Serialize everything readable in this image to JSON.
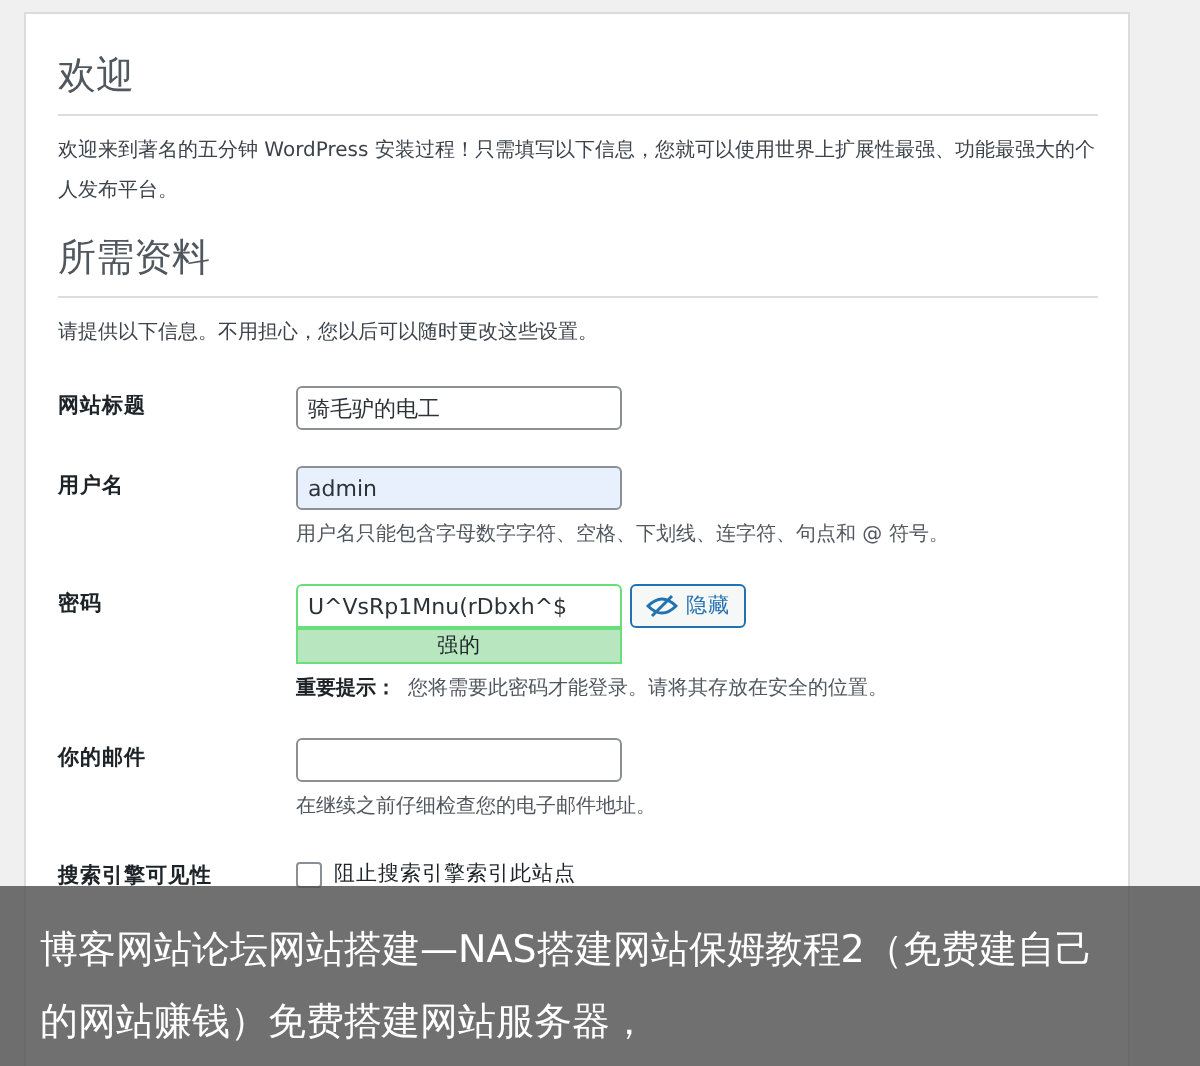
{
  "welcome": {
    "heading": "欢迎",
    "text": "欢迎来到著名的五分钟 WordPress 安装过程！只需填写以下信息，您就可以使用世界上扩展性最强、功能最强大的个人发布平台。"
  },
  "info": {
    "heading": "所需资料",
    "text": "请提供以下信息。不用担心，您以后可以随时更改这些设置。"
  },
  "fields": [
    {
      "kind": "text",
      "label": "网站标题",
      "value": "骑毛驴的电工"
    },
    {
      "kind": "text",
      "label": "用户名",
      "value": "admin",
      "autofilled": true,
      "hint": "用户名只能包含字母数字字符、空格、下划线、连字符、句点和 @ 符号。"
    },
    {
      "kind": "password",
      "label": "密码",
      "value": "U^VsRp1Mnu(rDbxh^$",
      "button": "隐藏",
      "strength": "强的",
      "hint_bold": "重要提示：",
      "hint": "您将需要此密码才能登录。请将其存放在安全的位置。"
    },
    {
      "kind": "text",
      "label": "你的邮件",
      "hint": "在继续之前仔细检查您的电子邮件地址。"
    },
    {
      "kind": "checkbox",
      "label": "搜索引擎可见性",
      "option": "阻止搜索引擎索引此站点",
      "checked": false
    }
  ],
  "caption": "博客网站论坛网站搭建—NAS搭建网站保姆教程2（免费建自己的网站赚钱）免费搭建网站服务器，"
}
